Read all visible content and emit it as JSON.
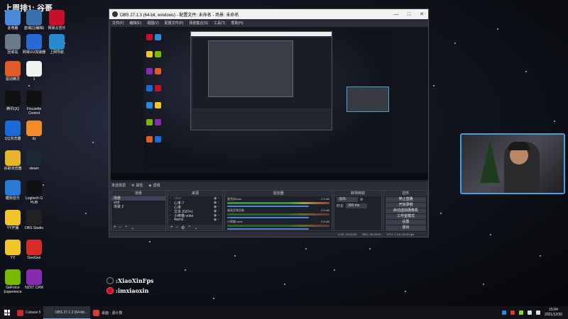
{
  "stream_header": "上周排1: 谷哥",
  "desktop_icons": [
    {
      "label": "此电脑",
      "icon": "computer-icon",
      "color": "#4a8ad8"
    },
    {
      "label": "蓝魂边(编辑)",
      "icon": "app-icon",
      "color": "#3a6fb0"
    },
    {
      "label": "网易云音乐",
      "icon": "music-icon",
      "color": "#c8102e"
    },
    {
      "label": "回收站",
      "icon": "recycle-bin-icon",
      "color": "#6a7a8a"
    },
    {
      "label": "网易UU加速器",
      "icon": "accelerator-icon",
      "color": "#2a6ad0"
    },
    {
      "label": "上网导航",
      "icon": "browser-icon",
      "color": "#2a8ad0"
    },
    {
      "label": "驱动精灵",
      "icon": "driver-icon",
      "color": "#e05a2a"
    },
    {
      "label": "1",
      "icon": "arrow-icon",
      "color": "#f2f2f2"
    },
    {
      "label": "腾讯QQ",
      "icon": "qq-icon",
      "color": "#111111"
    },
    {
      "label": "Focusrite Control",
      "icon": "bars-icon",
      "color": "#111111"
    },
    {
      "label": "QQ浏览器",
      "icon": "qq-browser-icon",
      "color": "#1a6ad8"
    },
    {
      "label": "dy",
      "icon": "dy-icon",
      "color": "#f08a2a"
    },
    {
      "label": "谷歌浏览器",
      "icon": "chrome-icon",
      "color": "#e8b62a"
    },
    {
      "label": "steam",
      "icon": "steam-icon",
      "color": "#1b2838"
    },
    {
      "label": "酷狗音乐",
      "icon": "kugou-icon",
      "color": "#2a7ad8"
    },
    {
      "label": "Logitech G HUB",
      "icon": "logitech-icon",
      "color": "#111111"
    },
    {
      "label": "YY开播",
      "icon": "yy-icon",
      "color": "#f2c62a"
    },
    {
      "label": "OBS Studio",
      "icon": "obs-icon",
      "color": "#222222"
    },
    {
      "label": "YY",
      "icon": "yy-app-icon",
      "color": "#f2c62a"
    },
    {
      "label": "GeeGee",
      "icon": "geegee-icon",
      "color": "#d82a2a"
    },
    {
      "label": "GeForce Experience",
      "icon": "nvidia-icon",
      "color": "#76b900"
    },
    {
      "label": "NZXT CAM",
      "icon": "nzxt-icon",
      "color": "#8a2ab0"
    }
  ],
  "social": {
    "douyin_handle": ":XiaoXinFps",
    "weibo_handle": ":imxiaoxin"
  },
  "obs": {
    "title": "OBS 27.1.3 (64-bit, windows) - 配置文件: 未命名 - 场景: 未命名",
    "menu": [
      "文件(F)",
      "编辑(E)",
      "视图(V)",
      "配置文件(P)",
      "场景集合(S)",
      "工具(T)",
      "帮助(H)"
    ],
    "src_bar_label": "未选择源",
    "properties_label": "属性",
    "filters_label": "滤镜",
    "scenes_title": "场景",
    "scenes": [
      "场景",
      "end",
      "场景 2"
    ],
    "sources_title": "来源",
    "sources": [
      {
        "name": "olive",
        "dim": true
      },
      {
        "name": "心率-7",
        "dim": false
      },
      {
        "name": "心率",
        "dim": false
      },
      {
        "name": "文本 (GDI+)",
        "dim": false
      },
      {
        "name": "小倒猫 vobe",
        "dim": false
      },
      {
        "name": "4sens",
        "dim": false
      }
    ],
    "mixer_title": "混音器",
    "mixer": [
      {
        "name": "麦克风/Aux",
        "level": "0.0 dB"
      },
      {
        "name": "桌面音频设备",
        "level": "0.0 dB"
      },
      {
        "name": "小倒猫 vobe",
        "level": "0.0 dB"
      }
    ],
    "transitions_title": "转场特效",
    "transition_type": "淡出",
    "duration_label": "时长",
    "duration_value": "300 ms",
    "controls_title": "控件",
    "controls": [
      "停止直播",
      "开始录制",
      "启动虚拟摄像机",
      "工作室模式",
      "设置",
      "退出"
    ],
    "status": {
      "dropped": "LIVE: 00:00:00",
      "rec": "REC: 00:00:00",
      "cpu": "CPU: 1.1%, 60.00 fps"
    }
  },
  "taskbar": {
    "items": [
      {
        "label": "Cubase 5",
        "icon": "cubase-icon",
        "color": "#c82a2a",
        "active": false
      },
      {
        "label": "OBS 27.1.3 (64-bit...",
        "icon": "obs-icon",
        "color": "#333333",
        "active": true
      },
      {
        "label": "桌面 - 源计数",
        "icon": "stream-icon",
        "color": "#d83a3a",
        "active": false
      }
    ],
    "time": "15:04",
    "date": "2021/12/30"
  }
}
